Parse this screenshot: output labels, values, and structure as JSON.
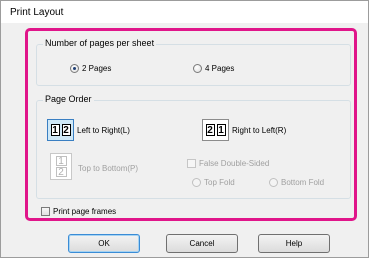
{
  "window": {
    "title": "Print Layout"
  },
  "pages_per_sheet": {
    "legend": "Number of pages per sheet",
    "options": [
      {
        "label": "2 Pages",
        "selected": true
      },
      {
        "label": "4 Pages",
        "selected": false
      }
    ]
  },
  "page_order": {
    "legend": "Page Order",
    "left_to_right": {
      "label": "Left to Right(L)",
      "digits": [
        "1",
        "2"
      ],
      "selected": true
    },
    "right_to_left": {
      "label": "Right to Left(R)",
      "digits": [
        "2",
        "1"
      ],
      "selected": false
    },
    "top_to_bottom": {
      "label": "Top to Bottom(P)",
      "digits": [
        "1",
        "2"
      ],
      "enabled": false
    },
    "false_double_sided": {
      "label": "False Double-Sided",
      "checked": false,
      "enabled": false
    },
    "fold": [
      {
        "label": "Top Fold",
        "enabled": false
      },
      {
        "label": "Bottom Fold",
        "enabled": false
      }
    ]
  },
  "print_page_frames": {
    "label": "Print page frames",
    "checked": false
  },
  "buttons": {
    "ok": "OK",
    "cancel": "Cancel",
    "help": "Help"
  },
  "colors": {
    "highlight": "#e0158a",
    "selected_tile": "#cfe8f7"
  }
}
